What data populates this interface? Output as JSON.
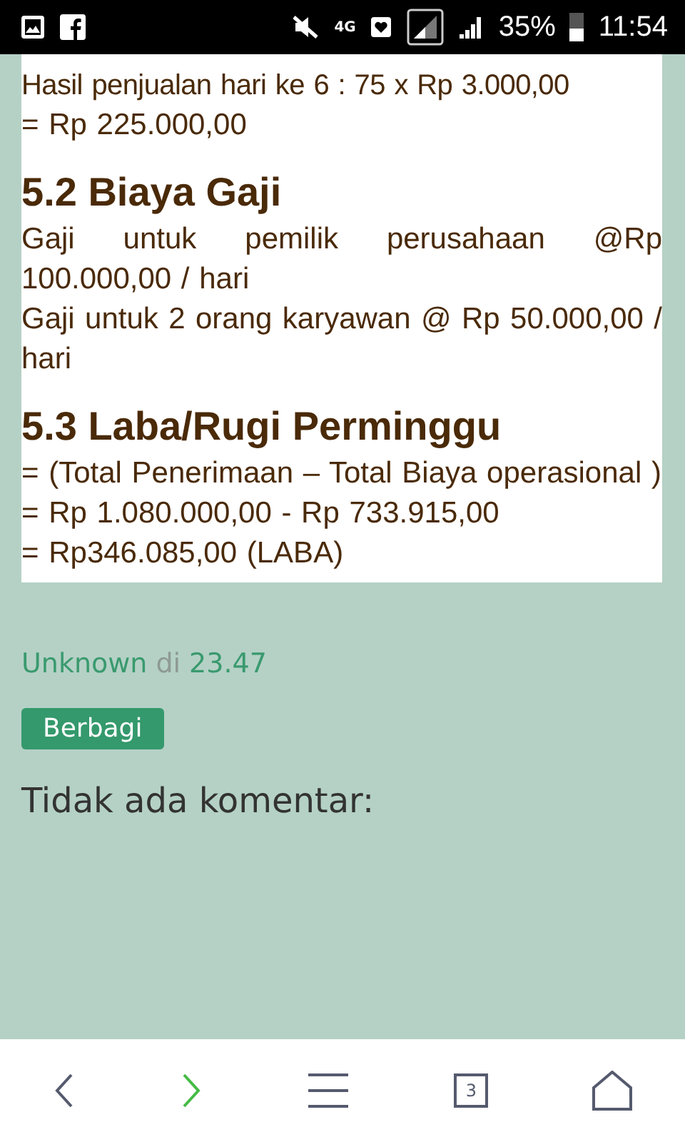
{
  "status_bar": {
    "network": "4G",
    "battery": "35%",
    "time": "11:54"
  },
  "article": {
    "blocks": [
      {
        "kind": "para",
        "text": "Hasil penjualan hari ke 6 : 75 x Rp 3.000,00"
      },
      {
        "kind": "para",
        "text": "= Rp 225.000,00"
      },
      {
        "kind": "heading",
        "text": "5.2 Biaya Gaji"
      },
      {
        "kind": "para",
        "text": "Gaji untuk pemilik perusahaan @Rp 100.000,00 / hari"
      },
      {
        "kind": "para",
        "text": "Gaji untuk 2 orang karyawan @ Rp  50.000,00 / hari"
      },
      {
        "kind": "heading",
        "text": "5.3 Laba/Rugi Perminggu"
      },
      {
        "kind": "para",
        "text": "= (Total Penerimaan – Total Biaya operasional )"
      },
      {
        "kind": "para",
        "text": "= Rp 1.080.000,00  -  Rp 733.915,00"
      },
      {
        "kind": "para",
        "text": "= Rp346.085,00 (LABA)"
      }
    ]
  },
  "post_footer": {
    "author": "Unknown",
    "joiner": "di",
    "time": "23.47"
  },
  "share_button": "Berbagi",
  "comments_heading": "Tidak ada komentar:",
  "nav_bar": {
    "tab_count": "3"
  }
}
